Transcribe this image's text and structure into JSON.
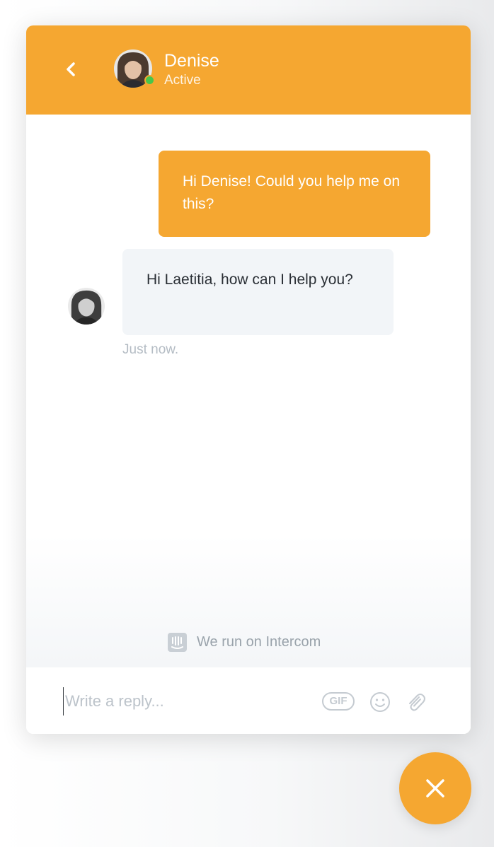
{
  "colors": {
    "brand": "#f5a731",
    "status_active": "#48c64a",
    "admin_bubble": "#f2f5f8"
  },
  "header": {
    "back_icon": "chevron-left-icon",
    "agent_name": "Denise",
    "agent_status": "Active"
  },
  "conversation": {
    "messages": [
      {
        "author": "user",
        "text": "Hi Denise! Could you help me on this?"
      },
      {
        "author": "admin",
        "text": "Hi Laetitia, how can I help you?"
      }
    ],
    "timestamp": "Just now."
  },
  "footer": {
    "powered_by": "We run on Intercom",
    "logo_icon": "intercom-logo-icon"
  },
  "composer": {
    "placeholder": "Write a reply...",
    "gif_label": "GIF",
    "emoji_icon": "emoji-icon",
    "attach_icon": "paperclip-icon"
  },
  "launcher": {
    "icon": "close-icon"
  }
}
